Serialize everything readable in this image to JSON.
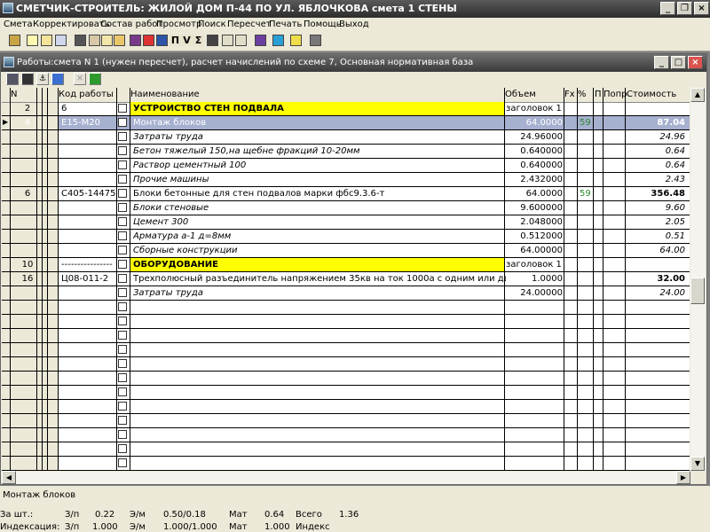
{
  "window": {
    "title": "СМЕТЧИК-СТРОИТЕЛЬ: ЖИЛОЙ ДОМ П-44 ПО УЛ. ЯБЛОЧКОВА смета 1 СТЕНЫ",
    "min_glyph": "_",
    "restore_glyph": "❐",
    "close_glyph": "×"
  },
  "menu": [
    {
      "label": "Смета"
    },
    {
      "label": "Корректировать"
    },
    {
      "label": "Состав работ"
    },
    {
      "label": "Просмотр"
    },
    {
      "label": "Поиск"
    },
    {
      "label": "Пересчет"
    },
    {
      "label": "Печать"
    },
    {
      "label": "Помощь"
    },
    {
      "label": "Выход"
    }
  ],
  "child": {
    "title": "Работы:смета  N 1 (нужен пересчет), расчет начислений по схеме  7, Основная нормативная база",
    "min_glyph": "_",
    "max_glyph": "□",
    "close_glyph": "×"
  },
  "grid": {
    "headers": {
      "n": "N",
      "code": "Код работы",
      "name": "Наименование",
      "qty": "Объем",
      "fx": "Fx %",
      "p": "П",
      "popr": "Попр",
      "cost": "Стоимость"
    },
    "rows": [
      {
        "n": "2",
        "code": "6",
        "name": "УСТРОЙСТВО СТЕН ПОДВАЛА",
        "qty": "заголовок 1",
        "fx": "",
        "cost": "",
        "type": "header"
      },
      {
        "n": "4",
        "code": "Е15-М20",
        "name": "Монтаж блоков",
        "qty": "64.0000",
        "fx": "59",
        "cost": "87.04",
        "type": "selected"
      },
      {
        "n": "",
        "code": "",
        "name": "Затраты труда",
        "qty": "24.96000",
        "fx": "",
        "cost": "24.96",
        "type": "sub"
      },
      {
        "n": "",
        "code": "",
        "name": "Бетон тяжелый 150,на щебне фракций 10-20мм",
        "qty": "0.640000",
        "fx": "",
        "cost": "0.64",
        "type": "sub"
      },
      {
        "n": "",
        "code": "",
        "name": "Раствор цементный 100",
        "qty": "0.640000",
        "fx": "",
        "cost": "0.64",
        "type": "sub"
      },
      {
        "n": "",
        "code": "",
        "name": "Прочие машины",
        "qty": "2.432000",
        "fx": "",
        "cost": "2.43",
        "type": "sub"
      },
      {
        "n": "6",
        "code": "С405-14475",
        "name": "Блоки бетонные для стен подвалов марки фбс9.3.6-т",
        "qty": "64.0000",
        "fx": "59",
        "cost": "356.48",
        "type": "work"
      },
      {
        "n": "",
        "code": "",
        "name": "Блоки стеновые",
        "qty": "9.600000",
        "fx": "",
        "cost": "9.60",
        "type": "sub"
      },
      {
        "n": "",
        "code": "",
        "name": "Цемент 300",
        "qty": "2.048000",
        "fx": "",
        "cost": "2.05",
        "type": "sub"
      },
      {
        "n": "",
        "code": "",
        "name": "Арматура а-1 д=8мм",
        "qty": "0.512000",
        "fx": "",
        "cost": "0.51",
        "type": "sub"
      },
      {
        "n": "",
        "code": "",
        "name": "Сборные конструкции",
        "qty": "64.00000",
        "fx": "",
        "cost": "64.00",
        "type": "sub"
      },
      {
        "n": "10",
        "code": "----------------",
        "name": "ОБОРУДОВАНИЕ",
        "qty": "заголовок 1",
        "fx": "",
        "cost": "",
        "type": "header"
      },
      {
        "n": "16",
        "code": "Ц08-011-2",
        "name": "Трехполюсный разъединитель напряжением 35кв на ток 1000а с одним или двумя заземл",
        "qty": "1.0000",
        "fx": "",
        "cost": "32.00",
        "type": "work"
      },
      {
        "n": "",
        "code": "",
        "name": "Затраты труда",
        "qty": "24.00000",
        "fx": "",
        "cost": "24.00",
        "type": "sub"
      }
    ]
  },
  "status": {
    "current": "Монтаж блоков",
    "line1": {
      "label": "За шт.:",
      "zp_label": "З/п",
      "zp": "0.22",
      "em_label": "Э/м",
      "em": "0.50/0.18",
      "mat_label": "Мат",
      "mat": "0.64",
      "total_label": "Всего",
      "total": "1.36"
    },
    "line2": {
      "label": "Индексация:",
      "zp_label": "З/п",
      "zp": "1.000",
      "em_label": "Э/м",
      "em": "1.000/1.000",
      "mat_label": "Мат",
      "mat": "1.000",
      "index_label": "Индекс"
    }
  },
  "colors": {
    "header_row": "#ffff00",
    "selected_row": "#a6b0cf",
    "fx_green": "#2e8b2e"
  }
}
